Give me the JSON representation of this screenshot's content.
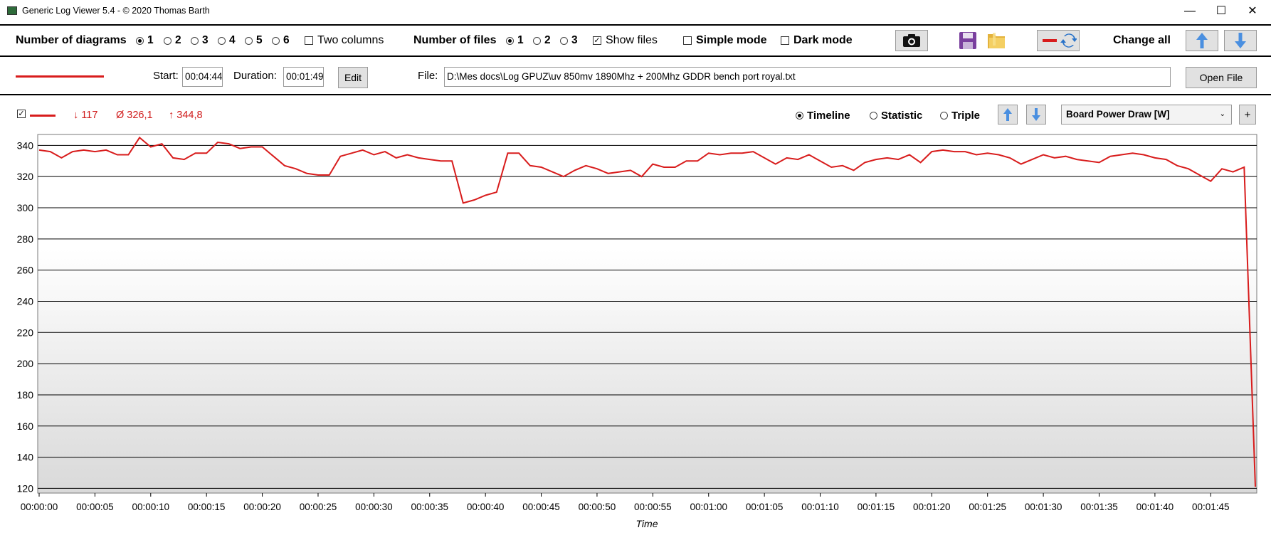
{
  "window": {
    "title": "Generic Log Viewer 5.4 - © 2020 Thomas Barth",
    "minimize": "—",
    "maximize": "☐",
    "close": "✕"
  },
  "toolbar": {
    "diagrams_label": "Number of diagrams",
    "diagram_options": [
      "1",
      "2",
      "3",
      "4",
      "5",
      "6"
    ],
    "diagrams_selected": "1",
    "two_columns": "Two columns",
    "files_label": "Number of files",
    "file_options": [
      "1",
      "2",
      "3"
    ],
    "files_selected": "1",
    "show_files": "Show files",
    "simple_mode": "Simple mode",
    "dark_mode": "Dark mode",
    "change_all": "Change all"
  },
  "file_row": {
    "start_label": "Start:",
    "start_value": "00:04:44",
    "duration_label": "Duration:",
    "duration_value": "00:01:49",
    "edit_button": "Edit",
    "file_label": "File:",
    "file_path": "D:\\Mes docs\\Log GPUZ\\uv 850mv 1890Mhz + 200Mhz GDDR bench port royal.txt",
    "open_button": "Open File",
    "series_color": "#d81c1c"
  },
  "diagram_header": {
    "min_text": "↓ 117",
    "avg_text": "Ø 326,1",
    "max_text": "↑ 344,8",
    "mode_timeline": "Timeline",
    "mode_statistic": "Statistic",
    "mode_triple": "Triple",
    "sensor_select": "Board Power Draw [W]",
    "add_button": "+"
  },
  "chart_data": {
    "type": "line",
    "xlabel": "Time",
    "ylabel": "",
    "ylim": [
      117,
      347
    ],
    "yticks": [
      120,
      140,
      160,
      180,
      200,
      220,
      240,
      260,
      280,
      300,
      320,
      340
    ],
    "xtick_labels": [
      "00:00:00",
      "00:00:05",
      "00:00:10",
      "00:00:15",
      "00:00:20",
      "00:00:25",
      "00:00:30",
      "00:00:35",
      "00:00:40",
      "00:00:45",
      "00:00:50",
      "00:00:55",
      "00:01:00",
      "00:01:05",
      "00:01:10",
      "00:01:15",
      "00:01:20",
      "00:01:25",
      "00:01:30",
      "00:01:35",
      "00:01:40",
      "00:01:45"
    ],
    "xtick_seconds": [
      0,
      5,
      10,
      15,
      20,
      25,
      30,
      35,
      40,
      45,
      50,
      55,
      60,
      65,
      70,
      75,
      80,
      85,
      90,
      95,
      100,
      105
    ],
    "xlim": [
      0,
      109
    ],
    "grid": true,
    "series": [
      {
        "color": "#d81c1c",
        "x": [
          0,
          1,
          2,
          3,
          4,
          5,
          6,
          7,
          8,
          9,
          10,
          11,
          12,
          13,
          14,
          15,
          16,
          17,
          18,
          19,
          20,
          21,
          22,
          23,
          24,
          25,
          26,
          27,
          28,
          29,
          30,
          31,
          32,
          33,
          34,
          35,
          36,
          37,
          38,
          39,
          40,
          41,
          42,
          43,
          44,
          45,
          46,
          47,
          48,
          49,
          50,
          51,
          52,
          53,
          54,
          55,
          56,
          57,
          58,
          59,
          60,
          61,
          62,
          63,
          64,
          65,
          66,
          67,
          68,
          69,
          70,
          71,
          72,
          73,
          74,
          75,
          76,
          77,
          78,
          79,
          80,
          81,
          82,
          83,
          84,
          85,
          86,
          87,
          88,
          89,
          90,
          91,
          92,
          93,
          94,
          95,
          96,
          97,
          98,
          99,
          100,
          101,
          102,
          103,
          104,
          105,
          106,
          107,
          108,
          109
        ],
        "values": [
          337,
          336,
          332,
          336,
          337,
          336,
          337,
          334,
          334,
          345,
          339,
          341,
          332,
          331,
          335,
          335,
          342,
          341,
          338,
          339,
          339,
          333,
          327,
          325,
          322,
          321,
          321,
          333,
          335,
          337,
          334,
          336,
          332,
          334,
          332,
          331,
          330,
          330,
          303,
          305,
          308,
          310,
          335,
          335,
          327,
          326,
          323,
          320,
          324,
          327,
          325,
          322,
          323,
          324,
          320,
          328,
          326,
          326,
          330,
          330,
          335,
          334,
          335,
          335,
          336,
          332,
          328,
          332,
          331,
          334,
          330,
          326,
          327,
          324,
          329,
          331,
          332,
          331,
          334,
          329,
          336,
          337,
          336,
          336,
          334,
          335,
          334,
          332,
          328,
          331,
          334,
          332,
          333,
          331,
          330,
          329,
          333,
          334,
          335,
          334,
          332,
          331,
          327,
          325,
          321,
          317,
          325,
          323,
          326,
          121
        ]
      }
    ]
  }
}
